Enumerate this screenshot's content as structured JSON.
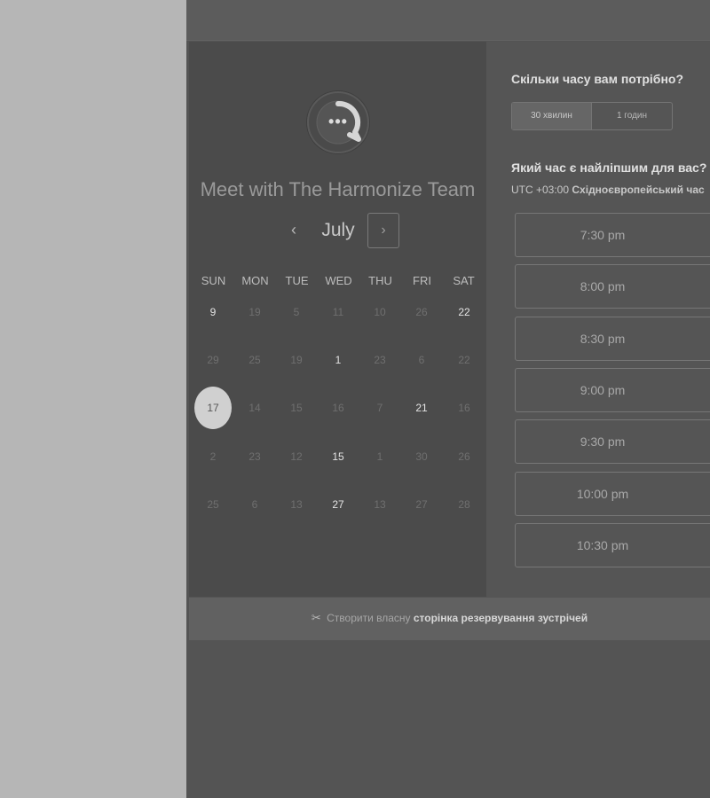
{
  "scheduler": {
    "team_name": "Meet with The Harmonize Team",
    "logo_glyph": "•••",
    "calendar": {
      "month": "July",
      "prev_glyph": "‹",
      "next_glyph": "›",
      "weekdays": [
        "SUN",
        "MON",
        "TUE",
        "WED",
        "THU",
        "FRI",
        "SAT"
      ],
      "weeks": [
        [
          {
            "label": "9",
            "available": true
          },
          {
            "label": "19",
            "available": false
          },
          {
            "label": "5",
            "available": false
          },
          {
            "label": "11",
            "available": false
          },
          {
            "label": "10",
            "available": false
          },
          {
            "label": "26",
            "available": false
          },
          {
            "label": "22",
            "available": true
          }
        ],
        [
          {
            "label": "29",
            "available": false
          },
          {
            "label": "25",
            "available": false
          },
          {
            "label": "19",
            "available": false
          },
          {
            "label": "1",
            "available": true
          },
          {
            "label": "23",
            "available": false
          },
          {
            "label": "6",
            "available": false
          },
          {
            "label": "22",
            "available": false
          }
        ],
        [
          {
            "label": "17",
            "available": true,
            "selected": true
          },
          {
            "label": "14",
            "available": false
          },
          {
            "label": "15",
            "available": false
          },
          {
            "label": "16",
            "available": false
          },
          {
            "label": "7",
            "available": false
          },
          {
            "label": "21",
            "available": true
          },
          {
            "label": "16",
            "available": false
          }
        ],
        [
          {
            "label": "2",
            "available": false
          },
          {
            "label": "23",
            "available": false
          },
          {
            "label": "12",
            "available": false
          },
          {
            "label": "15",
            "available": true
          },
          {
            "label": "1",
            "available": false
          },
          {
            "label": "30",
            "available": false
          },
          {
            "label": "26",
            "available": false
          }
        ],
        [
          {
            "label": "25",
            "available": false
          },
          {
            "label": "6",
            "available": false
          },
          {
            "label": "13",
            "available": false
          },
          {
            "label": "27",
            "available": true
          },
          {
            "label": "13",
            "available": false
          },
          {
            "label": "27",
            "available": false
          },
          {
            "label": "28",
            "available": false
          }
        ]
      ]
    },
    "duration": {
      "question": "Скільки часу вам потрібно?",
      "options": [
        "30 хвилин",
        "1 годин"
      ],
      "selected": "30 хвилин"
    },
    "time": {
      "question": "Який час є найліпшим для вас?",
      "tz_offset": "UTC +03:00",
      "tz_name": "Східноєвропейський час",
      "slots": [
        "7:30 pm",
        "8:00 pm",
        "8:30 pm",
        "9:00 pm",
        "9:30 pm",
        "10:00 pm",
        "10:30 pm"
      ]
    }
  },
  "footer": {
    "icon": "scissors-icon",
    "icon_glyph": "✂",
    "prefix": "Створити власну",
    "link": "сторінка резервування зустрічей"
  },
  "colors": {
    "page_bg": "#b6b6b6",
    "app_bg": "#545454",
    "calendar_bg": "#4b4b4b",
    "selected_day": "#d0d0d0"
  }
}
